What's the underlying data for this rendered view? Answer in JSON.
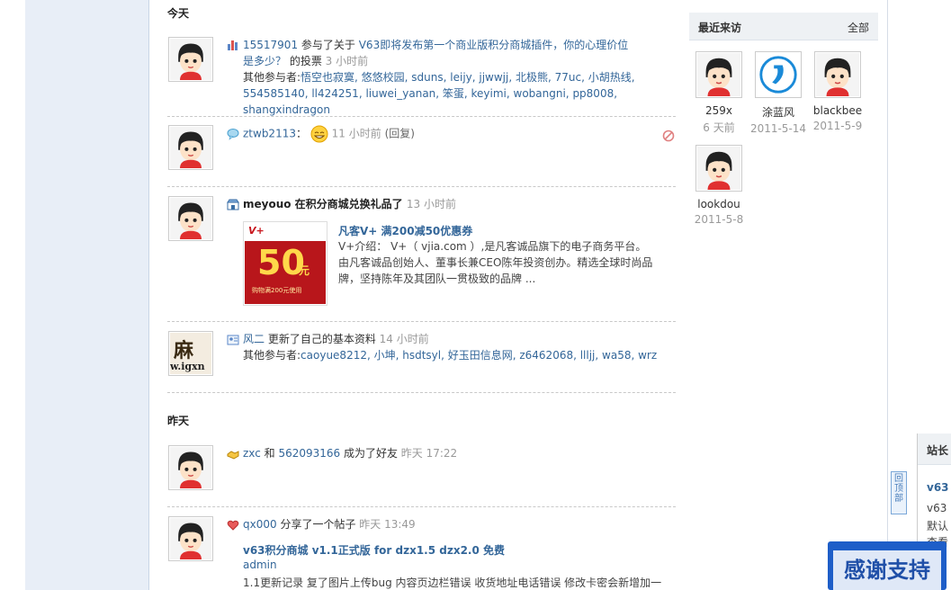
{
  "sections": {
    "today": "今天",
    "yesterday": "昨天"
  },
  "feed": [
    {
      "user": "15517901",
      "text": " 参与了关于 ",
      "link": "V63即将发布第一个商业版积分商城插件，你的心理价位是多少？",
      "suffix": " 的投票 ",
      "time": "3 小时前",
      "others_label": "其他参与者:",
      "others": "悟空也寂寞, 悠悠校园, sduns, leijy, jjwwjj, 北极熊, 77uc, 小胡热线, 554585140, ll424251, liuwei_yanan, 笨蛋, keyimi, wobangni, pp8008, shangxindragon"
    },
    {
      "user": "ztwb2113",
      "colon": "：",
      "time": "11 小时前",
      "reply": "(回复)"
    },
    {
      "user": "meyouo",
      "text": " 在积分商城兑换礼品了 ",
      "time": "13 小时前",
      "share_title": "凡客V+ 满200减50优惠券",
      "share_desc": "V+介绍： V+（ vjia.com ）,是凡客诚品旗下的电子商务平台。由凡客诚品创始人、董事长兼CEO陈年投资创办。精选全球时尚品牌，坚持陈年及其团队一贯极致的品牌 ...",
      "coupon_big": "50",
      "coupon_unit": "元",
      "coupon_brand": "V+",
      "coupon_small": "购物满200元使用"
    },
    {
      "user": "风二",
      "text": " 更新了自己的基本资料 ",
      "time": "14 小时前",
      "others_label": "其他参与者:",
      "others": "caoyue8212, 小坤, hsdtsyl, 好玉田信息网, z6462068, llljj, wa58, wrz",
      "avatar_text": "w.igxn"
    },
    {
      "user": "zxc",
      "text": " 和 ",
      "user2": "562093166",
      "suffix": " 成为了好友 ",
      "time": "昨天 17:22"
    },
    {
      "user": "qx000",
      "text": " 分享了一个帖子 ",
      "time": "昨天 13:49",
      "share_title": "v63积分商城 v1.1正式版 for dzx1.5 dzx2.0 免费",
      "share_author": "admin",
      "share_desc": "1.1更新记录 复了图片上传bug 内容页边栏错误 收货地址电话错误 修改卡密会新增加一"
    }
  ],
  "visitors": {
    "title": "最近来访",
    "all": "全部",
    "items": [
      {
        "name": "259x",
        "date": "6 天前"
      },
      {
        "name": "涂蓝风",
        "date": "2011-5-14"
      },
      {
        "name": "blackbee",
        "date": "2011-5-9"
      },
      {
        "name": "lookdou",
        "date": "2011-5-8"
      }
    ]
  },
  "announce": {
    "title": "站长",
    "line1": "v63",
    "line2": "v63",
    "line3": "默认",
    "line4": "查看"
  },
  "backtop": "回顶部",
  "thanks": "感谢支持"
}
